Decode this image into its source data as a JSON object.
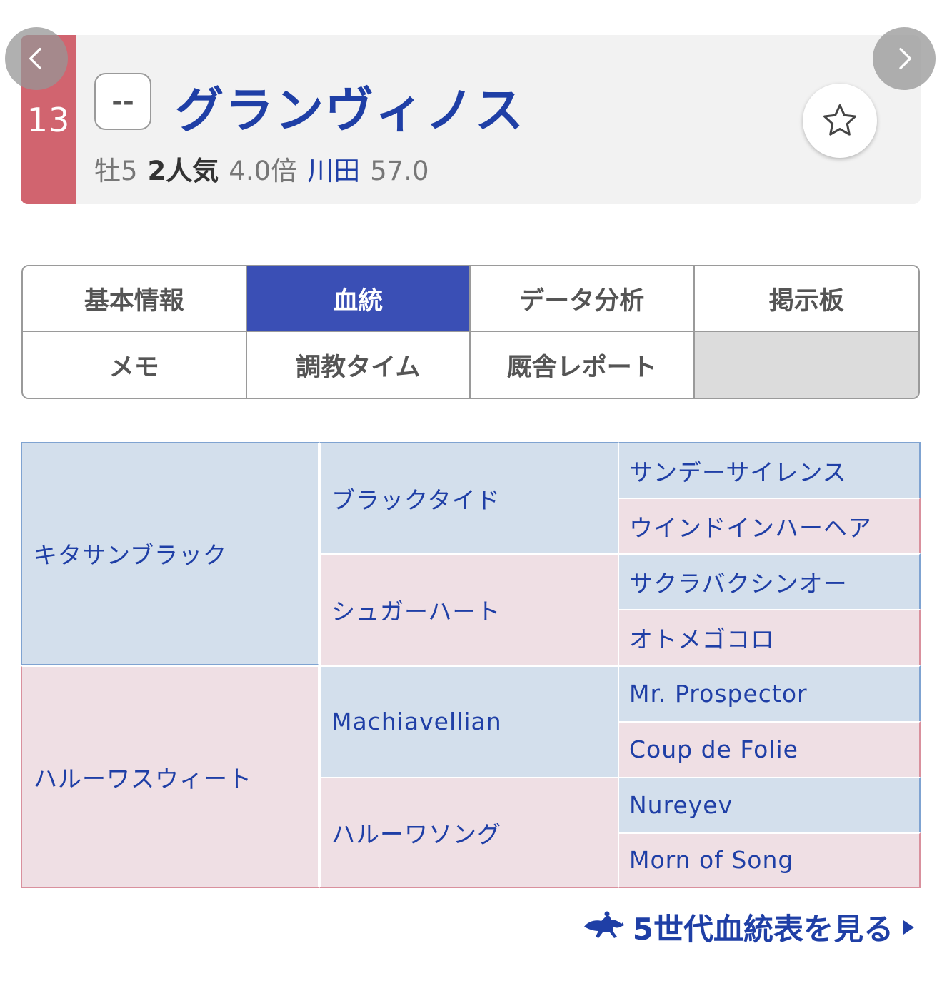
{
  "header": {
    "post_number": "13",
    "mark": "--",
    "horse_name": "グランヴィノス",
    "sex_age": "牡5",
    "popularity": "2人気",
    "odds": "4.0倍",
    "jockey": "川田",
    "weight": "57.0",
    "colors": {
      "post_strip": "#d1646f",
      "accent": "#1f3fa6"
    }
  },
  "navigation": {
    "prev_icon": "chevron-left-icon",
    "next_icon": "chevron-right-icon",
    "favorite_icon": "star-outline-icon"
  },
  "tabs": [
    {
      "label": "基本情報",
      "active": false
    },
    {
      "label": "血統",
      "active": true
    },
    {
      "label": "データ分析",
      "active": false
    },
    {
      "label": "掲示板",
      "active": false
    },
    {
      "label": "メモ",
      "active": false
    },
    {
      "label": "調教タイム",
      "active": false
    },
    {
      "label": "厩舎レポート",
      "active": false
    },
    {
      "label": "",
      "active": false
    }
  ],
  "pedigree": {
    "sire": "キタサンブラック",
    "dam": "ハルーワスウィート",
    "sire_sire": "ブラックタイド",
    "sire_dam": "シュガーハート",
    "dam_sire": "Machiavellian",
    "dam_dam": "ハルーワソング",
    "sss": "サンデーサイレンス",
    "ssd": "ウインドインハーヘア",
    "sds": "サクラバクシンオー",
    "sdd": "オトメゴコロ",
    "dss": "Mr. Prospector",
    "dsd": "Coup de Folie",
    "dds": "Nureyev",
    "ddd": "Morn of Song"
  },
  "footer": {
    "five_gen_label": "5世代血統表を見る",
    "icon": "horse-rider-icon"
  }
}
